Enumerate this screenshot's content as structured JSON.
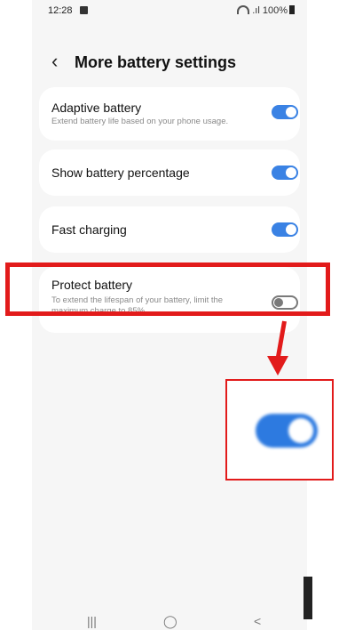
{
  "status_bar": {
    "time": "12:28",
    "battery": "100%"
  },
  "header": {
    "title": "More battery settings"
  },
  "settings": [
    {
      "title": "Adaptive battery",
      "subtitle": "Extend battery life based on your phone usage.",
      "enabled": true
    },
    {
      "title": "Show battery percentage",
      "subtitle": "",
      "enabled": true
    },
    {
      "title": "Fast charging",
      "subtitle": "",
      "enabled": true
    },
    {
      "title": "Protect battery",
      "subtitle_line1": "To extend the lifespan of your battery, limit the",
      "subtitle_line2": "maximum charge to 85%.",
      "enabled": false
    }
  ],
  "annotation": {
    "highlight_color": "#e21b1b",
    "zoomed_toggle_state": "on"
  },
  "nav": {
    "recents": "|||",
    "home": "◯",
    "back": "<"
  },
  "colors": {
    "accent": "#3a82e4",
    "background": "#f6f6f6"
  }
}
